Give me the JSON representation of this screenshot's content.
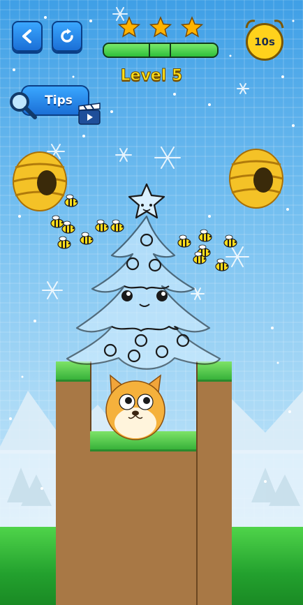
{
  "hud": {
    "back_icon": "back-arrow-icon",
    "restart_icon": "restart-icon",
    "stars_earned": 3,
    "stars_total": 3,
    "progress_fraction": 1.0,
    "level_label": "Level 5",
    "timer_label": "10s",
    "tips_label": "Tips",
    "tips_icons": [
      "magnifier-icon",
      "video-clapper-icon"
    ]
  },
  "colors": {
    "button_blue": "#2a8cf0",
    "progress_green": "#4fd44a",
    "level_yellow": "#ffe01a",
    "timer_yellow": "#ffd21c",
    "star_gold": "#ffb400"
  },
  "scene": {
    "hives": 2,
    "bees": 13,
    "character": "shiba-dog-ball",
    "drawing": "christmas-tree-outline"
  }
}
